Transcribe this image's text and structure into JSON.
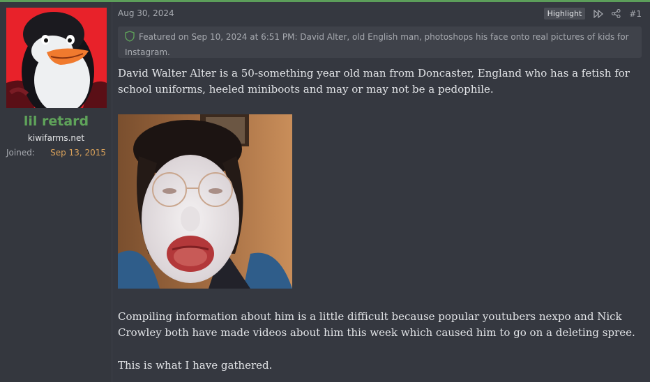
{
  "user": {
    "username": "lil retard",
    "site": "kiwifarms.net",
    "joined_label": "Joined:",
    "joined_date": "Sep 13, 2015",
    "avatar_icon": "penguin-avatar"
  },
  "post": {
    "date": "Aug 30, 2024",
    "highlight_label": "Highlight",
    "number": "#1",
    "featured_text": "Featured on Sep 10, 2024 at 6:51 PM: David Alter, old English man, photoshops his face onto real pictures of kids for Instagram.",
    "paragraphs": [
      "David Walter Alter is a 50-something year old man from Doncaster, England who has a fetish for school uniforms, heeled miniboots and may or may not be a pedophile.",
      "Compiling information about him is a little difficult because popular youtubers nexpo and Nick Crowley both have made videos about him this week which caused him to go on a deleting spree.",
      "This is what I have gathered."
    ]
  },
  "colors": {
    "accent_green": "#5fa35a",
    "joined_orange": "#d9a15a",
    "background": "#2f3238"
  }
}
